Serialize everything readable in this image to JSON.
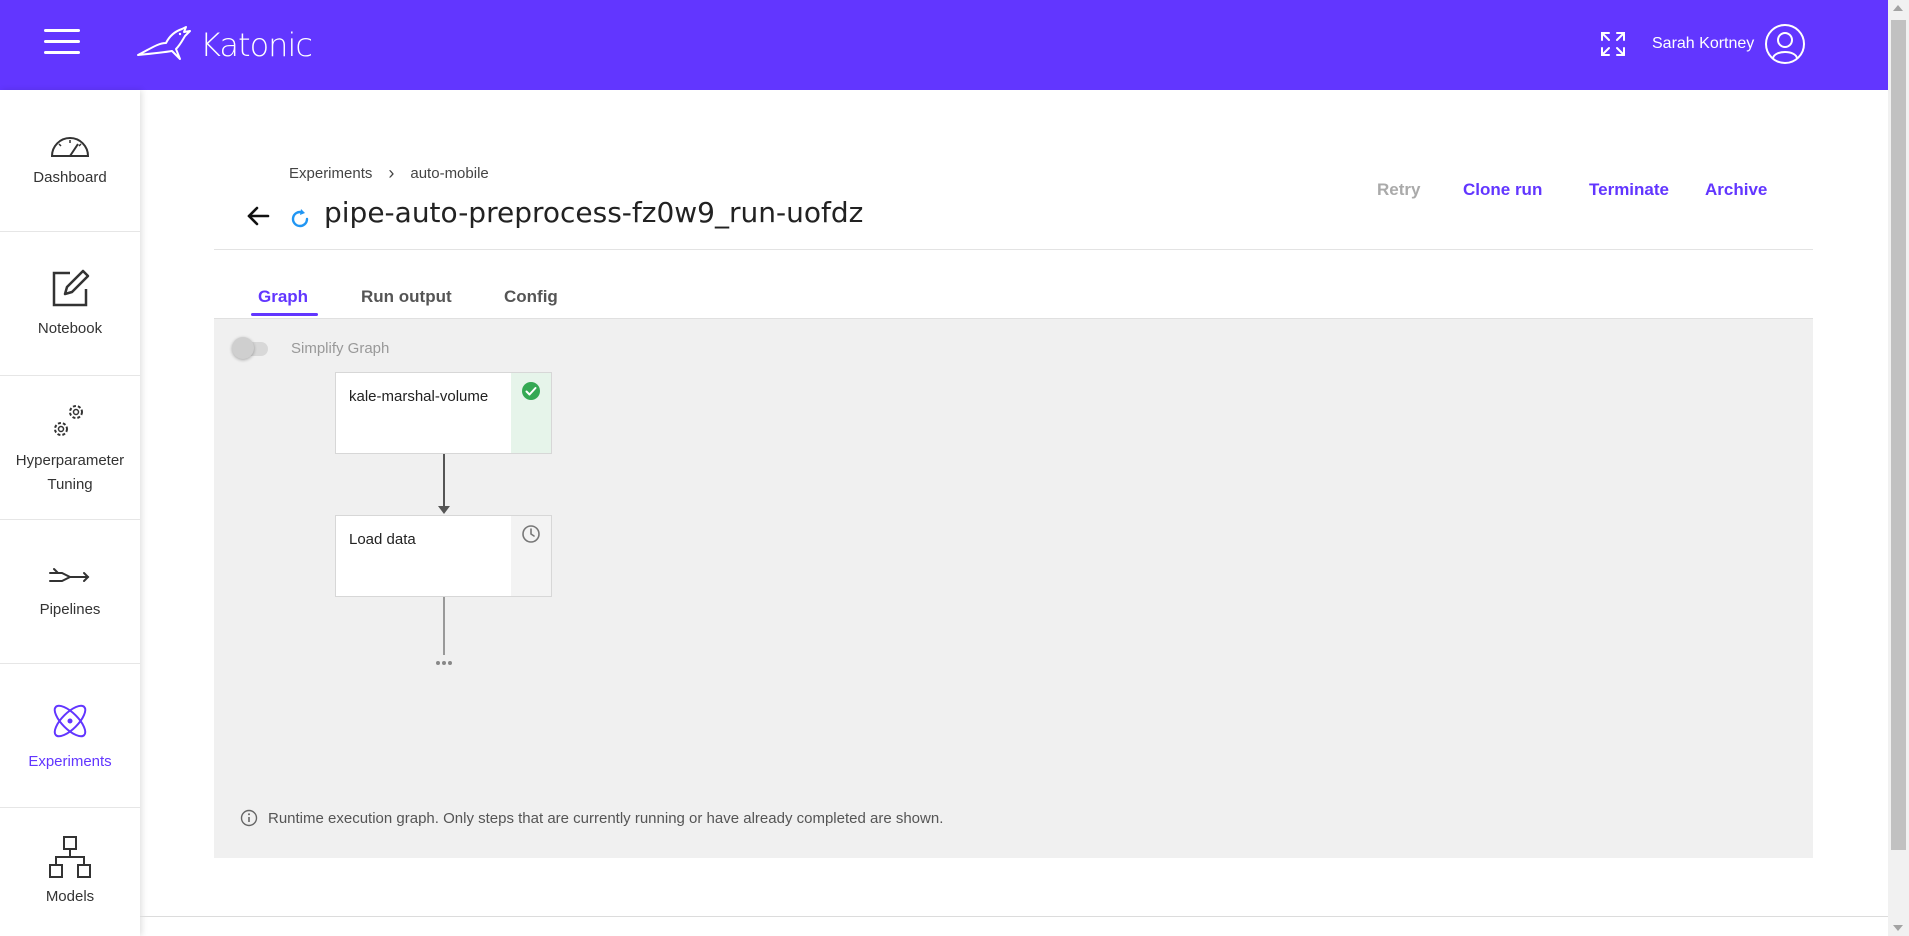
{
  "header": {
    "brand": "Katonic",
    "user_name": "Sarah Kortney"
  },
  "sidebar": {
    "items": [
      {
        "label": "Dashboard",
        "icon": "speedometer-icon",
        "active": false
      },
      {
        "label": "Notebook",
        "icon": "edit-icon",
        "active": false
      },
      {
        "label": "Hyperparameter Tuning",
        "icon": "gears-icon",
        "active": false
      },
      {
        "label": "Pipelines",
        "icon": "pipeline-icon",
        "active": false
      },
      {
        "label": "Experiments",
        "icon": "atom-icon",
        "active": true
      },
      {
        "label": "Models",
        "icon": "hierarchy-icon",
        "active": false
      }
    ]
  },
  "breadcrumb": {
    "root": "Experiments",
    "separator": "›",
    "current": "auto-mobile"
  },
  "run": {
    "title": "pipe-auto-preprocess-fz0w9_run-uofdz",
    "status": "running"
  },
  "actions": {
    "retry": "Retry",
    "clone": "Clone run",
    "terminate": "Terminate",
    "archive": "Archive"
  },
  "tabs": [
    {
      "label": "Graph",
      "active": true
    },
    {
      "label": "Run output",
      "active": false
    },
    {
      "label": "Config",
      "active": false
    }
  ],
  "graph": {
    "simplify_label": "Simplify Graph",
    "simplify_on": false,
    "nodes": [
      {
        "label": "kale-marshal-volume",
        "status": "succeeded"
      },
      {
        "label": "Load data",
        "status": "pending"
      }
    ],
    "info": "Runtime execution graph. Only steps that are currently running or have already completed are shown."
  },
  "colors": {
    "brand": "#6236ff",
    "success": "#34a853",
    "running": "#2196f3",
    "disabled": "#aaaaaa"
  }
}
